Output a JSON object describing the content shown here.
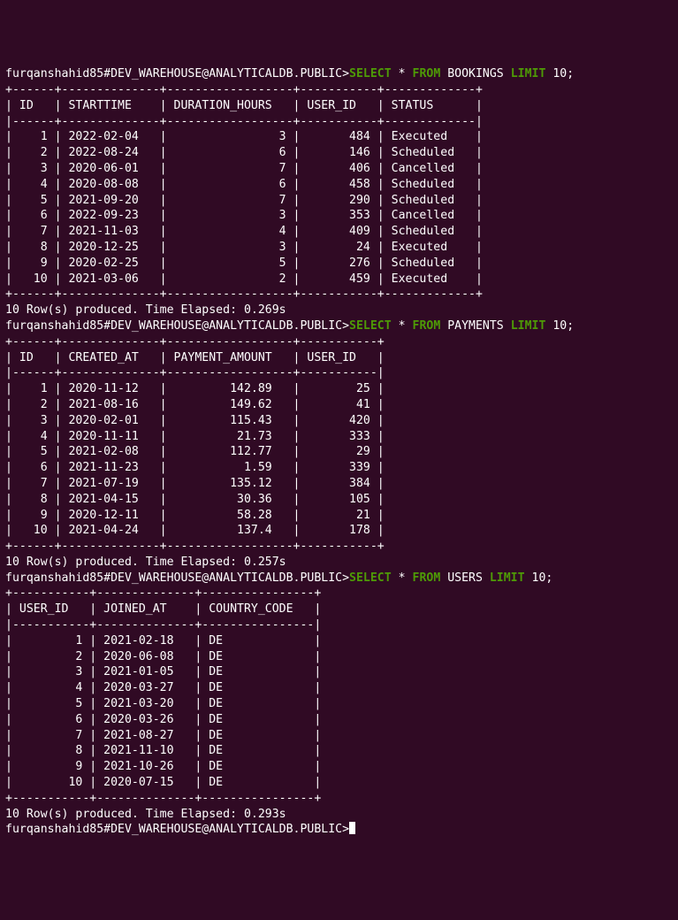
{
  "prompt": "furqanshahid85#DEV_WAREHOUSE@ANALYTICALDB.PUBLIC>",
  "sql": {
    "select": "SELECT",
    "star": "*",
    "from": "FROM",
    "limit": "LIMIT",
    "ten": "10",
    "semi": ";"
  },
  "queries": {
    "bookings": {
      "table": "BOOKINGS",
      "headers": [
        "ID",
        "STARTTIME",
        "DURATION_HOURS",
        "USER_ID",
        "STATUS"
      ],
      "rows": [
        {
          "id": 1,
          "starttime": "2022-02-04",
          "duration_hours": 3,
          "user_id": 484,
          "status": "Executed"
        },
        {
          "id": 2,
          "starttime": "2022-08-24",
          "duration_hours": 6,
          "user_id": 146,
          "status": "Scheduled"
        },
        {
          "id": 3,
          "starttime": "2020-06-01",
          "duration_hours": 7,
          "user_id": 406,
          "status": "Cancelled"
        },
        {
          "id": 4,
          "starttime": "2020-08-08",
          "duration_hours": 6,
          "user_id": 458,
          "status": "Scheduled"
        },
        {
          "id": 5,
          "starttime": "2021-09-20",
          "duration_hours": 7,
          "user_id": 290,
          "status": "Scheduled"
        },
        {
          "id": 6,
          "starttime": "2022-09-23",
          "duration_hours": 3,
          "user_id": 353,
          "status": "Cancelled"
        },
        {
          "id": 7,
          "starttime": "2021-11-03",
          "duration_hours": 4,
          "user_id": 409,
          "status": "Scheduled"
        },
        {
          "id": 8,
          "starttime": "2020-12-25",
          "duration_hours": 3,
          "user_id": 24,
          "status": "Executed"
        },
        {
          "id": 9,
          "starttime": "2020-02-25",
          "duration_hours": 5,
          "user_id": 276,
          "status": "Scheduled"
        },
        {
          "id": 10,
          "starttime": "2021-03-06",
          "duration_hours": 2,
          "user_id": 459,
          "status": "Executed"
        }
      ],
      "footer": "10 Row(s) produced. Time Elapsed: 0.269s"
    },
    "payments": {
      "table": "PAYMENTS",
      "headers": [
        "ID",
        "CREATED_AT",
        "PAYMENT_AMOUNT",
        "USER_ID"
      ],
      "rows": [
        {
          "id": 1,
          "created_at": "2020-11-12",
          "payment_amount": "142.89",
          "user_id": 25
        },
        {
          "id": 2,
          "created_at": "2021-08-16",
          "payment_amount": "149.62",
          "user_id": 41
        },
        {
          "id": 3,
          "created_at": "2020-02-01",
          "payment_amount": "115.43",
          "user_id": 420
        },
        {
          "id": 4,
          "created_at": "2020-11-11",
          "payment_amount": "21.73",
          "user_id": 333
        },
        {
          "id": 5,
          "created_at": "2021-02-08",
          "payment_amount": "112.77",
          "user_id": 29
        },
        {
          "id": 6,
          "created_at": "2021-11-23",
          "payment_amount": "1.59",
          "user_id": 339
        },
        {
          "id": 7,
          "created_at": "2021-07-19",
          "payment_amount": "135.12",
          "user_id": 384
        },
        {
          "id": 8,
          "created_at": "2021-04-15",
          "payment_amount": "30.36",
          "user_id": 105
        },
        {
          "id": 9,
          "created_at": "2020-12-11",
          "payment_amount": "58.28",
          "user_id": 21
        },
        {
          "id": 10,
          "created_at": "2021-04-24",
          "payment_amount": "137.4",
          "user_id": 178
        }
      ],
      "footer": "10 Row(s) produced. Time Elapsed: 0.257s"
    },
    "users": {
      "table": "USERS",
      "headers": [
        "USER_ID",
        "JOINED_AT",
        "COUNTRY_CODE"
      ],
      "rows": [
        {
          "user_id": 1,
          "joined_at": "2021-02-18",
          "country_code": "DE"
        },
        {
          "user_id": 2,
          "joined_at": "2020-06-08",
          "country_code": "DE"
        },
        {
          "user_id": 3,
          "joined_at": "2021-01-05",
          "country_code": "DE"
        },
        {
          "user_id": 4,
          "joined_at": "2020-03-27",
          "country_code": "DE"
        },
        {
          "user_id": 5,
          "joined_at": "2021-03-20",
          "country_code": "DE"
        },
        {
          "user_id": 6,
          "joined_at": "2020-03-26",
          "country_code": "DE"
        },
        {
          "user_id": 7,
          "joined_at": "2021-08-27",
          "country_code": "DE"
        },
        {
          "user_id": 8,
          "joined_at": "2021-11-10",
          "country_code": "DE"
        },
        {
          "user_id": 9,
          "joined_at": "2021-10-26",
          "country_code": "DE"
        },
        {
          "user_id": 10,
          "joined_at": "2020-07-15",
          "country_code": "DE"
        }
      ],
      "footer": "10 Row(s) produced. Time Elapsed: 0.293s"
    }
  }
}
